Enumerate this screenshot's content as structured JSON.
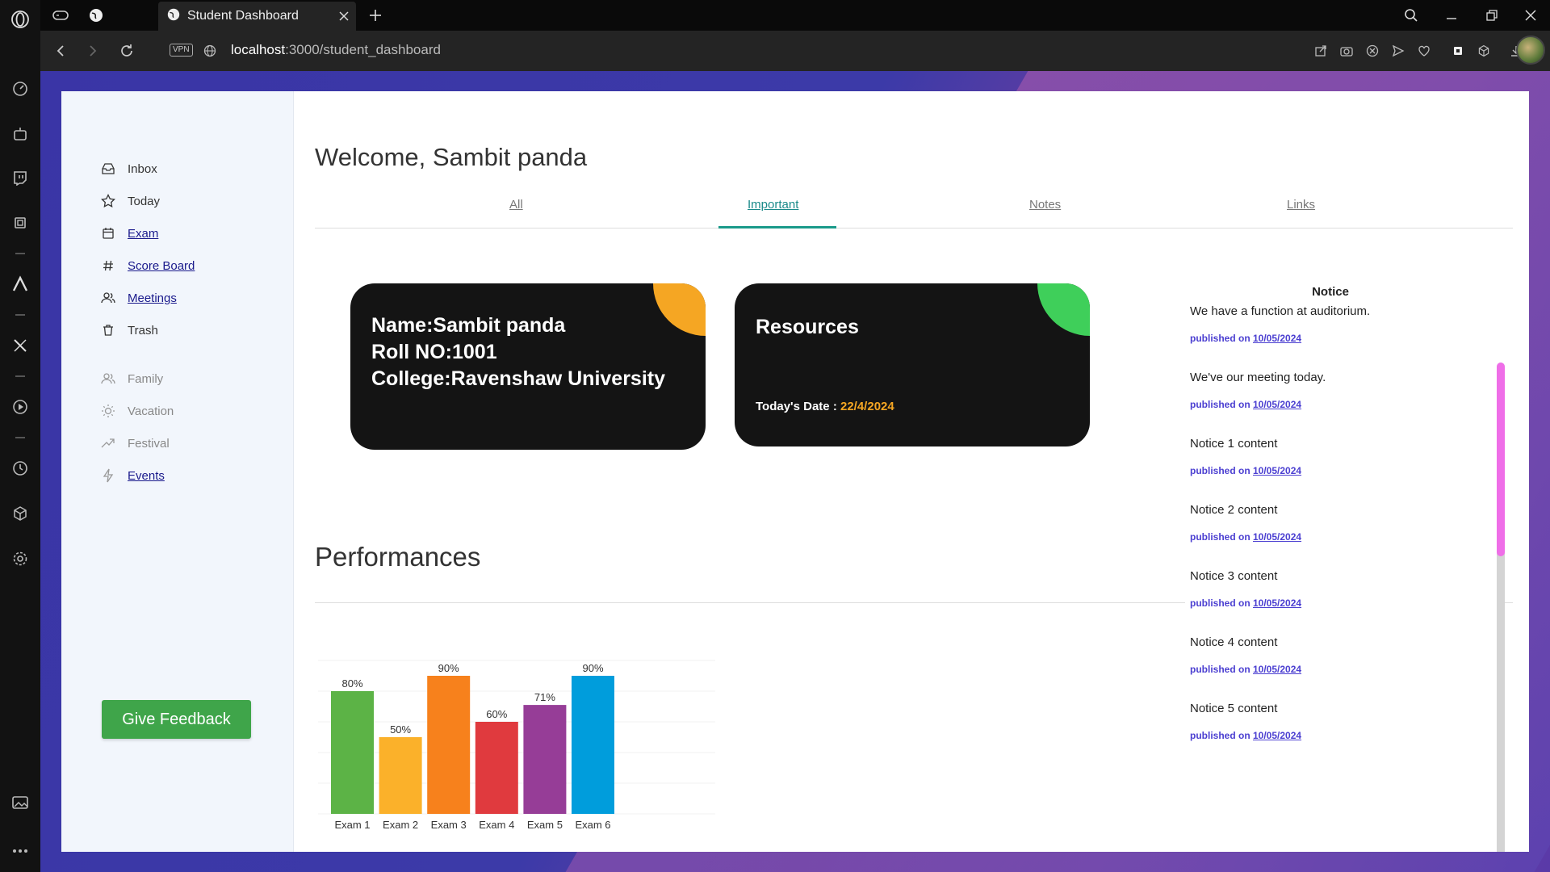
{
  "browser": {
    "tab_title": "Student Dashboard",
    "vpn_label": "VPN",
    "url_host": "localhost",
    "url_path": ":3000/student_dashboard"
  },
  "sidebar": {
    "primary": [
      {
        "label": "Inbox",
        "icon": "inbox-icon",
        "link": false
      },
      {
        "label": "Today",
        "icon": "star-icon",
        "link": false
      },
      {
        "label": "Exam",
        "icon": "calendar-icon",
        "link": true
      },
      {
        "label": "Score Board",
        "icon": "hash-icon",
        "link": true
      },
      {
        "label": "Meetings",
        "icon": "users-icon",
        "link": true
      },
      {
        "label": "Trash",
        "icon": "trash-icon",
        "link": false
      }
    ],
    "secondary": [
      {
        "label": "Family",
        "icon": "users-icon",
        "link": false
      },
      {
        "label": "Vacation",
        "icon": "sun-icon",
        "link": false
      },
      {
        "label": "Festival",
        "icon": "trending-icon",
        "link": false
      },
      {
        "label": "Events",
        "icon": "bolt-icon",
        "link": true
      }
    ],
    "feedback_label": "Give Feedback"
  },
  "main": {
    "welcome": "Welcome, Sambit panda",
    "tabs": [
      {
        "label": "All"
      },
      {
        "label": "Important",
        "active": true
      },
      {
        "label": "Notes"
      },
      {
        "label": "Links"
      }
    ],
    "info_card": {
      "name": "Name:Sambit panda",
      "roll": "Roll NO:1001",
      "college": "College:Ravenshaw University",
      "accent": "#f5a623"
    },
    "resources_card": {
      "title": "Resources",
      "date_label": "Today's Date : ",
      "date_value": "22/4/2024",
      "accent": "#3fcf5a"
    },
    "performance_title": "Performances"
  },
  "notice": {
    "title": "Notice",
    "published_label": "published on",
    "items": [
      {
        "text": "We have a function at auditorium.",
        "date": "10/05/2024"
      },
      {
        "text": "We've our meeting today.",
        "date": "10/05/2024"
      },
      {
        "text": "Notice 1 content",
        "date": "10/05/2024"
      },
      {
        "text": "Notice 2 content",
        "date": "10/05/2024"
      },
      {
        "text": "Notice 3 content",
        "date": "10/05/2024"
      },
      {
        "text": "Notice 4 content",
        "date": "10/05/2024"
      },
      {
        "text": "Notice 5 content",
        "date": "10/05/2024"
      }
    ]
  },
  "chart_data": {
    "type": "bar",
    "categories": [
      "Exam 1",
      "Exam 2",
      "Exam 3",
      "Exam 4",
      "Exam 5",
      "Exam 6"
    ],
    "values": [
      80,
      50,
      90,
      60,
      71,
      90
    ],
    "labels": [
      "80%",
      "50%",
      "90%",
      "60%",
      "71%",
      "90%"
    ],
    "colors": [
      "#5cb346",
      "#fbb12a",
      "#f7811c",
      "#e03a3e",
      "#963d97",
      "#009ddc"
    ],
    "ylim": [
      0,
      100
    ],
    "grid": true
  }
}
